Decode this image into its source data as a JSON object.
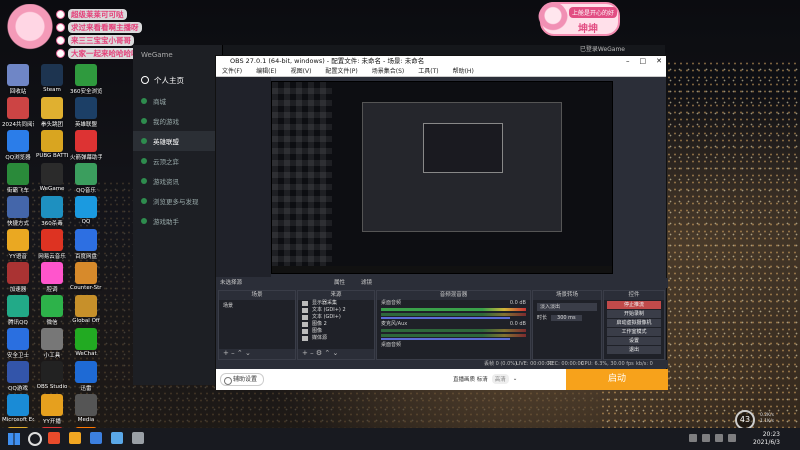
{
  "chat": {
    "lines": [
      "超级莱莱可可哒",
      "求过来看看啊主播呀",
      "来三三宝宝小哥哥",
      "大家一起来哈哈哈哈"
    ]
  },
  "badge": {
    "title": "上舱是开心的好",
    "name": "坤坤"
  },
  "desktop_icons": [
    {
      "label": "回收站",
      "color": "#6f86c6"
    },
    {
      "label": "Steam",
      "color": "#1d3450"
    },
    {
      "label": "360安全浏览器",
      "color": "#2f9a3e"
    },
    {
      "label": "2024共同阅读",
      "color": "#c44"
    },
    {
      "label": "拳头跳团",
      "color": "#e0b030"
    },
    {
      "label": "英雄联盟",
      "color": "#1c3f66"
    },
    {
      "label": "QQ浏览器",
      "color": "#2b7de9"
    },
    {
      "label": "PUBG BATTLEGR",
      "color": "#d9a520"
    },
    {
      "label": "火箭弹幕助手",
      "color": "#d33"
    },
    {
      "label": "街霸飞车",
      "color": "#2a8a3a"
    },
    {
      "label": "WeGame",
      "color": "#2b2b2b"
    },
    {
      "label": "QQ音乐",
      "color": "#3b9e5e"
    },
    {
      "label": "快捷方式",
      "color": "#46a"
    },
    {
      "label": "360杀毒",
      "color": "#1e90c0"
    },
    {
      "label": "QQ",
      "color": "#1b9ae0"
    },
    {
      "label": "YY语音",
      "color": "#eaa822"
    },
    {
      "label": "网易云音乐",
      "color": "#d32"
    },
    {
      "label": "百度网盘",
      "color": "#2d6fe2"
    },
    {
      "label": "加速器",
      "color": "#a33"
    },
    {
      "label": "腔调",
      "color": "#f5c"
    },
    {
      "label": "Counter-Strike",
      "color": "#d78a2b"
    },
    {
      "label": "腾讯QQ",
      "color": "#2a8"
    },
    {
      "label": "微信",
      "color": "#2db24a"
    },
    {
      "label": "Global Off",
      "color": "#c7902a"
    },
    {
      "label": "安全卫士",
      "color": "#2a6fe0"
    },
    {
      "label": "小工具",
      "color": "#777"
    },
    {
      "label": "WeChat",
      "color": "#2a2"
    },
    {
      "label": "QQ游戏",
      "color": "#35a"
    },
    {
      "label": "OBS Studio",
      "color": "#222"
    },
    {
      "label": "迅雷",
      "color": "#1e6ad5"
    },
    {
      "label": "Microsoft Edge",
      "color": "#1a8bd6"
    },
    {
      "label": "YY开播",
      "color": "#e6a01e"
    },
    {
      "label": "Media",
      "color": "#555"
    },
    {
      "label": "Potplayer",
      "color": "#e2ab2b"
    },
    {
      "label": "快手",
      "color": "#d33"
    },
    {
      "label": "斗鱼",
      "color": "#f70"
    }
  ],
  "wegame": {
    "header": "WeGame",
    "user": "个人主页",
    "items": [
      "商城",
      "我的游戏",
      "英雄联盟",
      "云顶之弈",
      "游戏资讯",
      "浏览更多与发现",
      "游戏助手"
    ],
    "active_index": 2,
    "login": "已登录WeGame"
  },
  "obs": {
    "title": "OBS 27.0.1 (64-bit, windows) - 配置文件: 未命名 - 场景: 未命名",
    "menu": [
      "文件(F)",
      "编辑(E)",
      "视图(V)",
      "配置文件(P)",
      "场景集合(S)",
      "工具(T)",
      "帮助(H)"
    ],
    "scene_bar_label": "未选择源",
    "filters": [
      "属性",
      "滤镜"
    ],
    "docks": {
      "scenes": {
        "title": "场景",
        "items": [
          "场景"
        ]
      },
      "sources": {
        "title": "来源",
        "items": [
          "显示器采集",
          "文本 (GDI+) 2",
          "文本 (GDI+)",
          "图像 2",
          "图像",
          "媒体源"
        ]
      },
      "mixer": {
        "title": "音频混音器",
        "channels": [
          {
            "name": "桌面音频",
            "db": "0.0 dB"
          },
          {
            "name": "麦克风/Aux",
            "db": "0.0 dB"
          }
        ]
      },
      "transitions": {
        "title": "场景转场",
        "type": "淡入淡出",
        "duration_label": "时长",
        "duration": "300 ms"
      },
      "controls": {
        "title": "控件",
        "buttons": [
          "停止推流",
          "开始录制",
          "启动虚拟摄像机",
          "工作室模式",
          "设置",
          "退出"
        ]
      }
    },
    "status": {
      "dropped": "丢帧 0 (0.0%)",
      "live": "LIVE: 00:00:00",
      "rec": "REC: 00:00:00",
      "cpu": "CPU: 6.3%, 30.00 fps",
      "kbps": "kb/s: 0"
    },
    "bottom": {
      "aux_button": "辅助设置",
      "stream_label": "直播画质 标清",
      "stream_pill": "高清",
      "start_button": "启动"
    }
  },
  "taskbar": {
    "app_colors": [
      "#e94b2b",
      "#f1a622",
      "#3c80e0",
      "#5aa8e8",
      "#9aa0a6"
    ],
    "time": "20:23",
    "date": "2021/6/3"
  },
  "overlay": {
    "temp": "43",
    "net_up": "0.2K/s",
    "net_down": "1.1K/s"
  }
}
